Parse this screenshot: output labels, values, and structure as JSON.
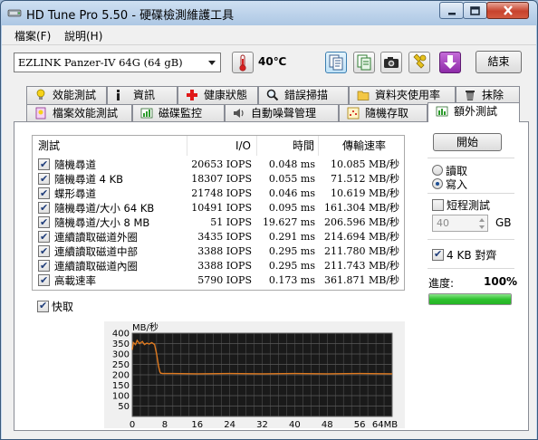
{
  "window": {
    "title": "HD Tune Pro 5.50 - 硬碟檢測維護工具"
  },
  "menu": {
    "items": [
      "檔案(F)",
      "說明(H)"
    ]
  },
  "toolbar": {
    "drive": "EZLINK Panzer-IV 64G (64 gB)",
    "temperature": "40℃",
    "exit_label": "結束",
    "icons": [
      "copy-icon",
      "copy-green-icon",
      "camera-icon",
      "wrench-icon",
      "download-icon"
    ]
  },
  "tabs_top": [
    {
      "label": "效能測試",
      "icon": "lightbulb-icon"
    },
    {
      "label": "資訊",
      "icon": "info-icon"
    },
    {
      "label": "健康狀態",
      "icon": "health-cross-icon"
    },
    {
      "label": "錯誤掃描",
      "icon": "magnifier-icon"
    },
    {
      "label": "資料夾使用率",
      "icon": "folder-icon"
    },
    {
      "label": "抹除",
      "icon": "trash-icon"
    }
  ],
  "tabs_bottom": [
    {
      "label": "檔案效能測試",
      "icon": "file-benchmark-icon"
    },
    {
      "label": "磁碟監控",
      "icon": "disk-monitor-icon"
    },
    {
      "label": "自動噪聲管理",
      "icon": "speaker-icon"
    },
    {
      "label": "隨機存取",
      "icon": "random-access-icon"
    },
    {
      "label": "額外測試",
      "icon": "extra-tests-icon",
      "selected": true
    }
  ],
  "test_table": {
    "columns": [
      "測試",
      "I/O",
      "時間",
      "傳輸速率"
    ],
    "rows": [
      {
        "name": "隨機尋道",
        "io": "20653 IOPS",
        "time": "0.048 ms",
        "rate": "10.085 MB/秒",
        "checked": true
      },
      {
        "name": "隨機尋道 4 KB",
        "io": "18307 IOPS",
        "time": "0.055 ms",
        "rate": "71.512 MB/秒",
        "checked": true
      },
      {
        "name": "蝶形尋道",
        "io": "21748 IOPS",
        "time": "0.046 ms",
        "rate": "10.619 MB/秒",
        "checked": true
      },
      {
        "name": "隨機尋道/大小 64 KB",
        "io": "10491 IOPS",
        "time": "0.095 ms",
        "rate": "161.304 MB/秒",
        "checked": true
      },
      {
        "name": "隨機尋道/大小 8 MB",
        "io": "51 IOPS",
        "time": "19.627 ms",
        "rate": "206.596 MB/秒",
        "checked": true
      },
      {
        "name": "連續讀取磁道外圈",
        "io": "3435 IOPS",
        "time": "0.291 ms",
        "rate": "214.694 MB/秒",
        "checked": true
      },
      {
        "name": "連續讀取磁道中部",
        "io": "3388 IOPS",
        "time": "0.295 ms",
        "rate": "211.780 MB/秒",
        "checked": true
      },
      {
        "name": "連續讀取磁道內圈",
        "io": "3388 IOPS",
        "time": "0.295 ms",
        "rate": "211.743 MB/秒",
        "checked": true
      },
      {
        "name": "高載速率",
        "io": "5790 IOPS",
        "time": "0.173 ms",
        "rate": "361.871 MB/秒",
        "checked": true
      }
    ]
  },
  "options": {
    "start_label": "開始",
    "read_label": "讀取",
    "write_label": "寫入",
    "selected_mode": "write",
    "short_test_label": "短程測試",
    "short_test_checked": false,
    "size_value": "40",
    "size_unit": "GB",
    "align_label": "4 KB 對齊",
    "align_checked": true,
    "progress_label": "進度:",
    "progress_value": "100%",
    "progress_fraction": 1.0,
    "fast_label": "快取",
    "fast_checked": true
  },
  "colors": {
    "accent": "#e07a1f",
    "progress": "#2fc22f",
    "chart_bg": "#1a1a1a",
    "grid": "#5a5a5a"
  },
  "chart_data": {
    "type": "line",
    "ylabel": "MB/秒",
    "xlabel": "",
    "ylim": [
      0,
      400
    ],
    "xlim": [
      0,
      64
    ],
    "y_ticks": [
      "400",
      "350",
      "300",
      "250",
      "200",
      "150",
      "100",
      "50"
    ],
    "x_ticks": [
      "0",
      "8",
      "16",
      "24",
      "32",
      "40",
      "48",
      "56",
      "64MB"
    ],
    "series": [
      {
        "x": [
          0,
          0.3,
          0.8,
          1.2,
          1.8,
          2.5,
          3.0,
          3.6,
          4.2,
          4.8,
          5.5,
          6.0,
          6.5,
          6.8,
          7.0,
          7.5,
          10,
          16,
          24,
          32,
          40,
          48,
          56,
          64
        ],
        "y": [
          320,
          355,
          345,
          365,
          350,
          360,
          345,
          352,
          348,
          355,
          345,
          300,
          240,
          215,
          208,
          206,
          206,
          205,
          206,
          205,
          206,
          205,
          206,
          205
        ]
      }
    ]
  }
}
